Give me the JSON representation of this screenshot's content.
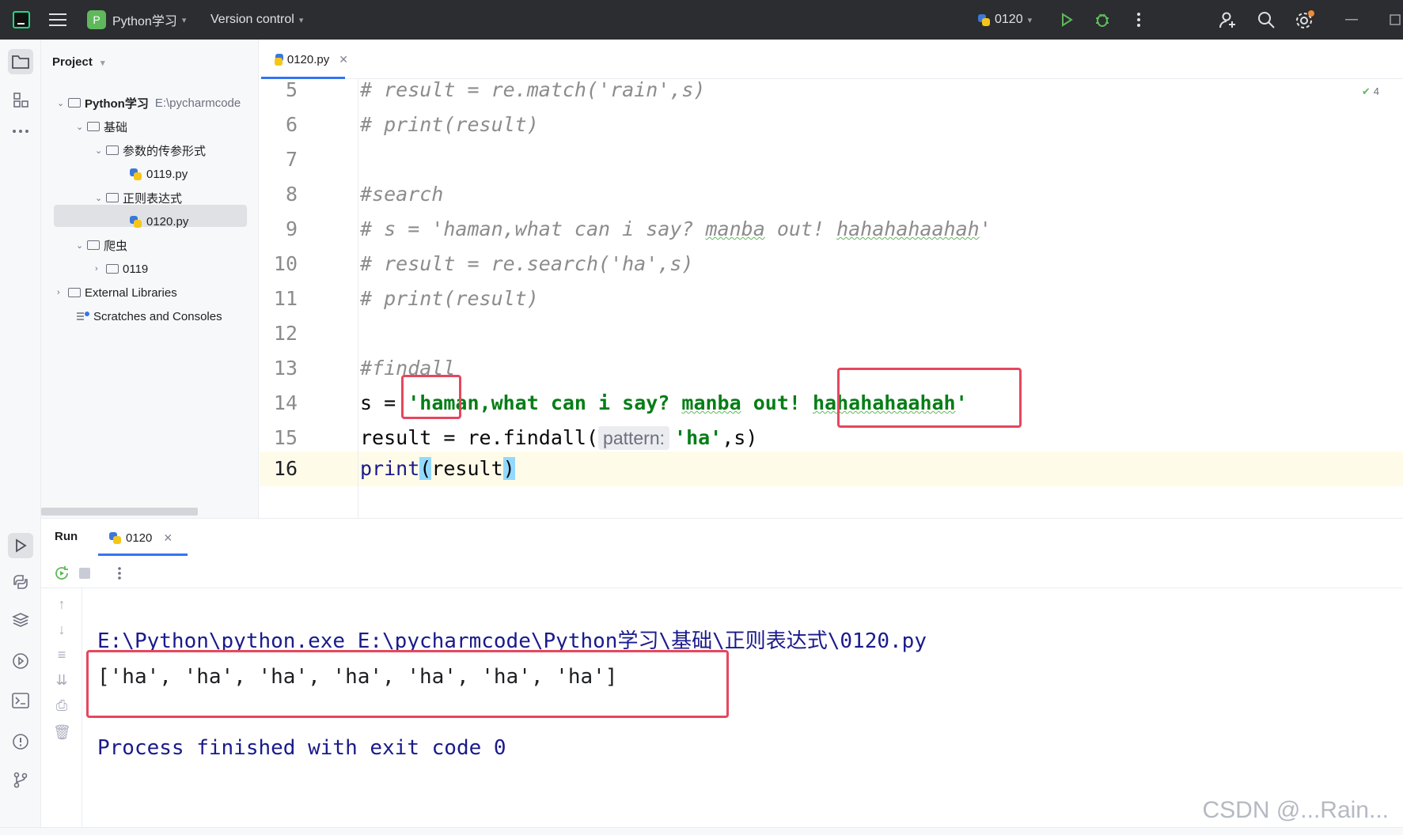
{
  "titlebar": {
    "project_name": "Python学习",
    "version_control": "Version control",
    "run_config": "0120"
  },
  "project_panel": {
    "title": "Project",
    "root_name": "Python学习",
    "root_path": "E:\\pycharmcode",
    "items": [
      {
        "label": "基础"
      },
      {
        "label": "参数的传参形式"
      },
      {
        "label": "0119.py"
      },
      {
        "label": "正则表达式"
      },
      {
        "label": "0120.py"
      },
      {
        "label": "爬虫"
      },
      {
        "label": "0119"
      },
      {
        "label": "External Libraries"
      },
      {
        "label": "Scratches and Consoles"
      }
    ]
  },
  "editor": {
    "tab_label": "0120.py",
    "inspection_count": "4",
    "line_numbers": [
      "5",
      "6",
      "7",
      "8",
      "9",
      "10",
      "11",
      "12",
      "13",
      "14",
      "15",
      "16"
    ],
    "lines": {
      "l5": "# result = re.match('rain',s)",
      "l6": "# print(result)",
      "l8": "#search",
      "l9a": "# s = 'haman,what can i say? ",
      "l9b": "manba",
      "l9c": " out! ",
      "l9d": "hahahahaahah",
      "l9e": "'",
      "l10": "# result = re.search('ha',s)",
      "l11": "# print(result)",
      "l13": "#findall",
      "l14a": "s = ",
      "l14b": "'haman,what can i say? ",
      "l14c": "manba",
      "l14d": " out! ",
      "l14e": "hahahahaahah",
      "l14f": "'",
      "l15a": "result = re.findall(",
      "l15hint": "pattern:",
      "l15b": "'ha'",
      "l15c": ",s)",
      "l16a": "print",
      "l16b": "(",
      "l16c": "result",
      "l16d": ")"
    }
  },
  "run_panel": {
    "title": "Run",
    "tab_label": "0120",
    "output": [
      "E:\\Python\\python.exe E:\\pycharmcode\\Python学习\\基础\\正则表达式\\0120.py",
      "['ha', 'ha', 'ha', 'ha', 'ha', 'ha', 'ha']",
      "",
      "Process finished with exit code 0"
    ]
  },
  "watermark": "CSDN @...Rain...",
  "colors": {
    "accent": "#3574f0",
    "highlight_box": "#e5475e",
    "string": "#067d17",
    "comment": "#8c8c8c",
    "output_blue": "#1a1a8c"
  }
}
